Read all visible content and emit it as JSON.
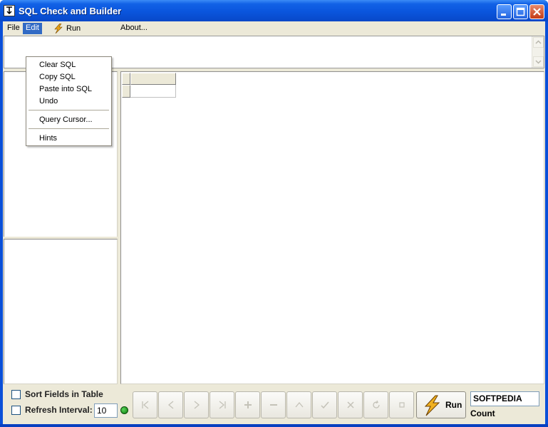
{
  "window": {
    "title": "SQL Check and Builder"
  },
  "menubar": {
    "file": "File",
    "edit": "Edit",
    "run": "Run",
    "about": "About..."
  },
  "edit_menu": {
    "items": [
      "Clear SQL",
      "Copy SQL",
      "Paste into SQL",
      "Undo",
      "Query Cursor...",
      "Hints"
    ]
  },
  "options": {
    "sort_fields_label": "Sort Fields in Table",
    "sort_fields_checked": false,
    "refresh_interval_label": "Refresh Interval:",
    "refresh_interval_checked": false,
    "refresh_interval_value": "10"
  },
  "navigator": {
    "buttons": [
      "first",
      "prior",
      "next",
      "last",
      "insert",
      "delete",
      "edit",
      "post",
      "cancel",
      "refresh",
      "stop"
    ]
  },
  "run_button": {
    "label": "Run"
  },
  "count": {
    "value": "SOFTPEDIA",
    "label": "Count"
  },
  "colors": {
    "titlebar": "#0a55dd",
    "menu_highlight": "#316ac5",
    "face": "#ece9d8",
    "led": "#1aa01a"
  }
}
